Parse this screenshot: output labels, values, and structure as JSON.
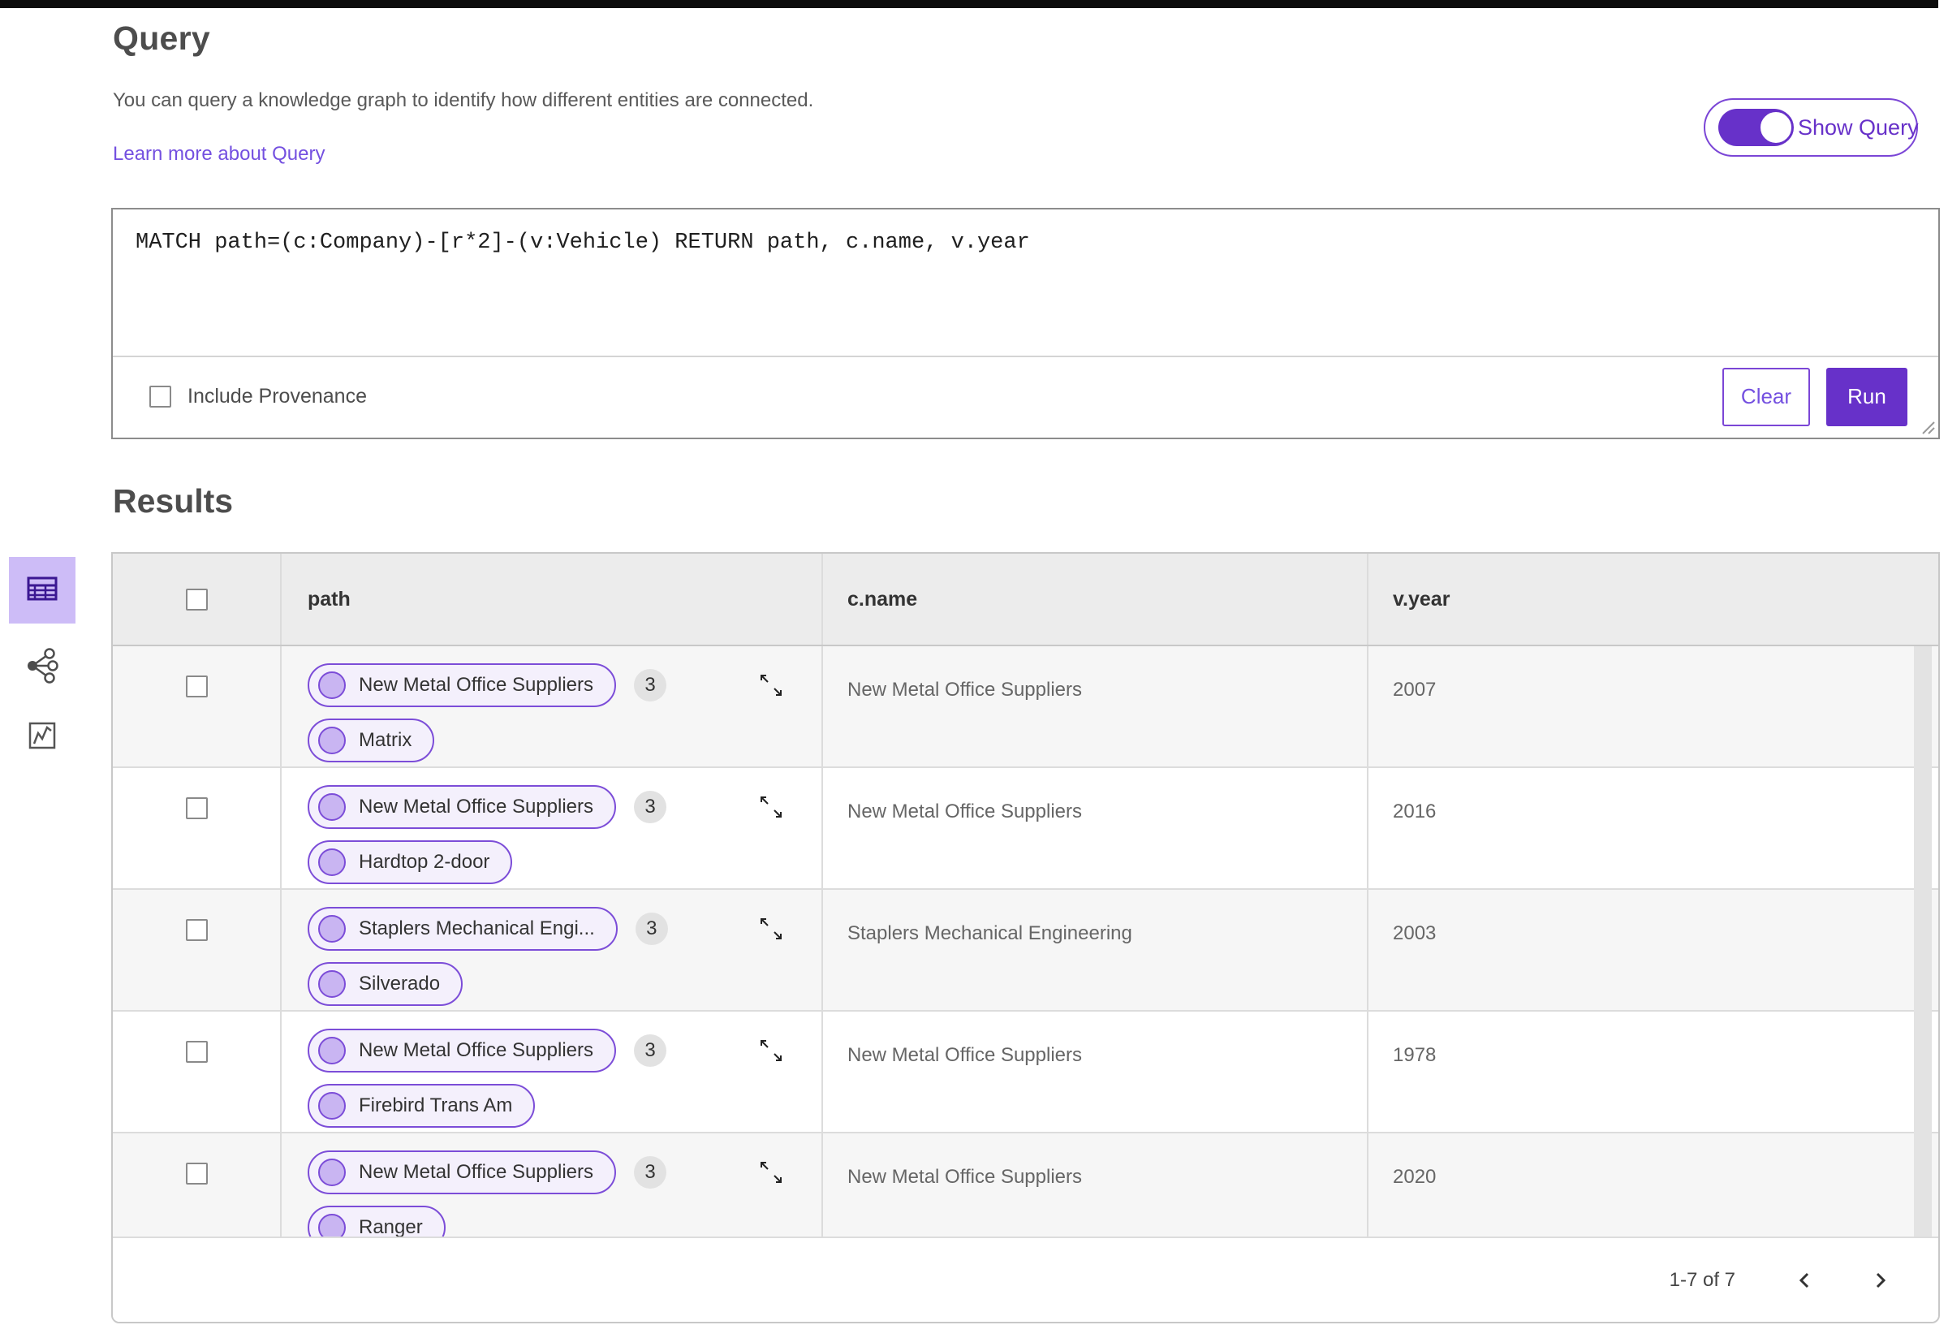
{
  "colors": {
    "accent_purple": "#6731c9",
    "accent_purple_light": "#cdbcf7",
    "pill_border": "#7c4dd8",
    "pill_fill": "#f4f0fc",
    "link_purple": "#7450e0",
    "badge_gray": "#e2e2e2",
    "table_header_gray": "#ececec",
    "row_alt_gray": "#f6f6f6"
  },
  "icons": {
    "table_view": "table-view-icon",
    "graph_view": "graph-network-icon",
    "chart_view": "chart-view-icon",
    "expand": "expand-diagonal-arrows-icon",
    "prev": "chevron-left-icon",
    "next": "chevron-right-icon",
    "resize": "textarea-resize-grip-icon"
  },
  "header": {
    "title": "Query",
    "description": "You can query a knowledge graph to identify how different entities are connected.",
    "learn_more_link": "Learn more about Query",
    "show_query_toggle": "Show Query"
  },
  "query_panel": {
    "query_text": "MATCH path=(c:Company)-[r*2]-(v:Vehicle) RETURN path, c.name, v.year",
    "include_provenance": "Include Provenance",
    "clear_button": "Clear",
    "run_button": "Run"
  },
  "results": {
    "title": "Results",
    "columns": {
      "path": "path",
      "c_name": "c.name",
      "v_year": "v.year"
    },
    "rows": [
      {
        "start_node": "New Metal Office Suppliers",
        "count": "3",
        "end_node": "Matrix",
        "c_name": "New Metal Office Suppliers",
        "v_year": "2007"
      },
      {
        "start_node": "New Metal Office Suppliers",
        "count": "3",
        "end_node": "Hardtop 2-door",
        "c_name": "New Metal Office Suppliers",
        "v_year": "2016"
      },
      {
        "start_node": "Staplers Mechanical Engi...",
        "count": "3",
        "end_node": "Silverado",
        "c_name": "Staplers Mechanical Engineering",
        "v_year": "2003"
      },
      {
        "start_node": "New Metal Office Suppliers",
        "count": "3",
        "end_node": "Firebird Trans Am",
        "c_name": "New Metal Office Suppliers",
        "v_year": "1978"
      },
      {
        "start_node": "New Metal Office Suppliers",
        "count": "3",
        "end_node": "Ranger",
        "c_name": "New Metal Office Suppliers",
        "v_year": "2020"
      }
    ],
    "pagination": {
      "range": "1-7 of 7"
    }
  }
}
